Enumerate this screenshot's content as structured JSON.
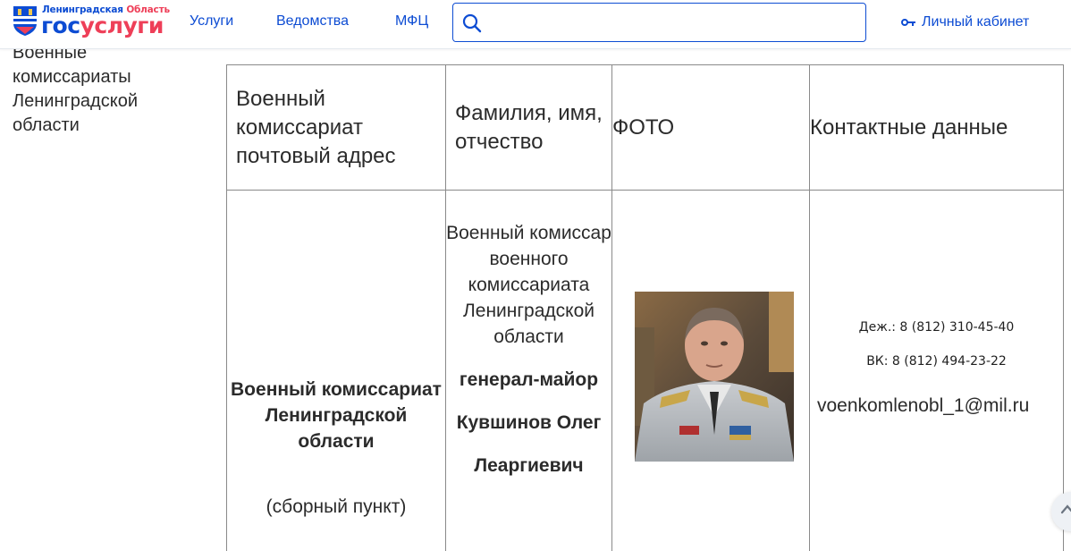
{
  "header": {
    "logo_region_1": "Ленинградская",
    "logo_region_2": "Область",
    "logo_text_1": "гос",
    "logo_text_2": "услуги",
    "nav": [
      "Услуги",
      "Ведомства",
      "МФЦ"
    ],
    "search_placeholder": "",
    "cabinet_label": "Личный кабинет",
    "icons": {
      "search": "search-icon",
      "cabinet": "key-icon",
      "emblem": "coat-of-arms-icon"
    }
  },
  "sidebar": {
    "link": "Военные комиссариаты Ленинградской области"
  },
  "table": {
    "headers": [
      "Военный комиссариат почтовый адрес",
      "Фамилия, имя, отчество",
      "ФОТО",
      "Контактные данные"
    ],
    "row": {
      "org": "Военный комиссариат Ленинградской области",
      "org_sub": "(сборный пункт)",
      "role": "Военный комиссар военного комиссариата Ленинградской области",
      "rank": "генерал-майор",
      "name_line1": "Кувшинов Олег",
      "name_line2": "Леаргиевич",
      "phone_duty": "Деж.: 8 (812) 310-45-40",
      "phone_vk": "ВК: 8 (812) 494-23-22",
      "email": "voenkomlenobl_1@mil.ru"
    }
  },
  "colors": {
    "brand_blue": "#0d4cd3",
    "brand_red": "#ee3f58",
    "border": "#8a8a8a",
    "text": "#2b2b2b"
  }
}
